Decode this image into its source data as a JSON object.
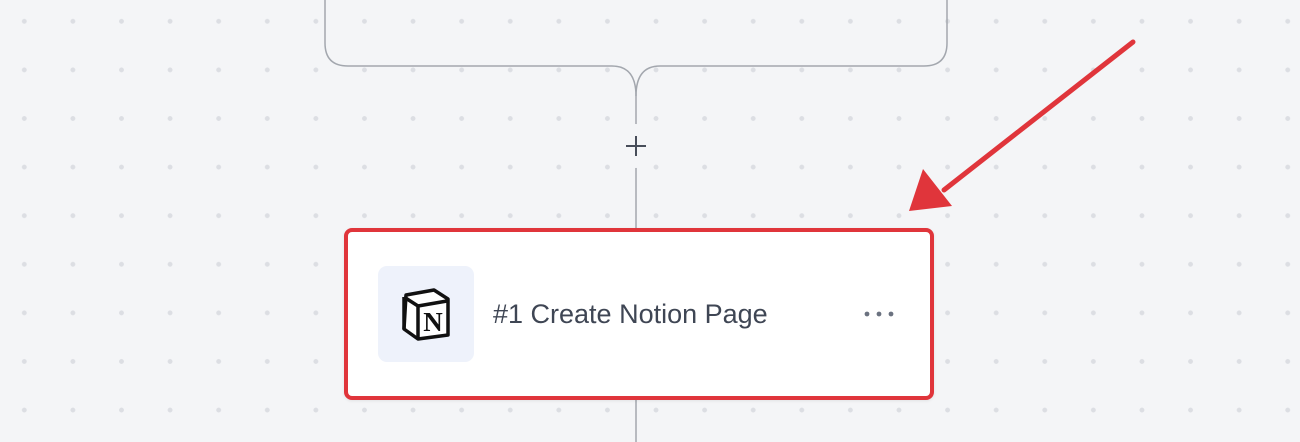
{
  "workflow": {
    "add_step": {
      "icon": "plus-icon",
      "accessible_label": "+"
    },
    "step": {
      "title": "#1 Create Notion Page",
      "app_icon": "notion-logo-icon",
      "app_icon_letter": "N",
      "menu_icon": "more-horizontal-icon"
    }
  },
  "annotation": {
    "arrow_icon": "annotation-arrow",
    "highlight_color": "#e0353b"
  },
  "theme": {
    "canvas_background": "#f4f5f7",
    "connector_color": "#a3a7ae",
    "text_color": "#3f4654",
    "icon_tile_background": "#eef2fb"
  }
}
